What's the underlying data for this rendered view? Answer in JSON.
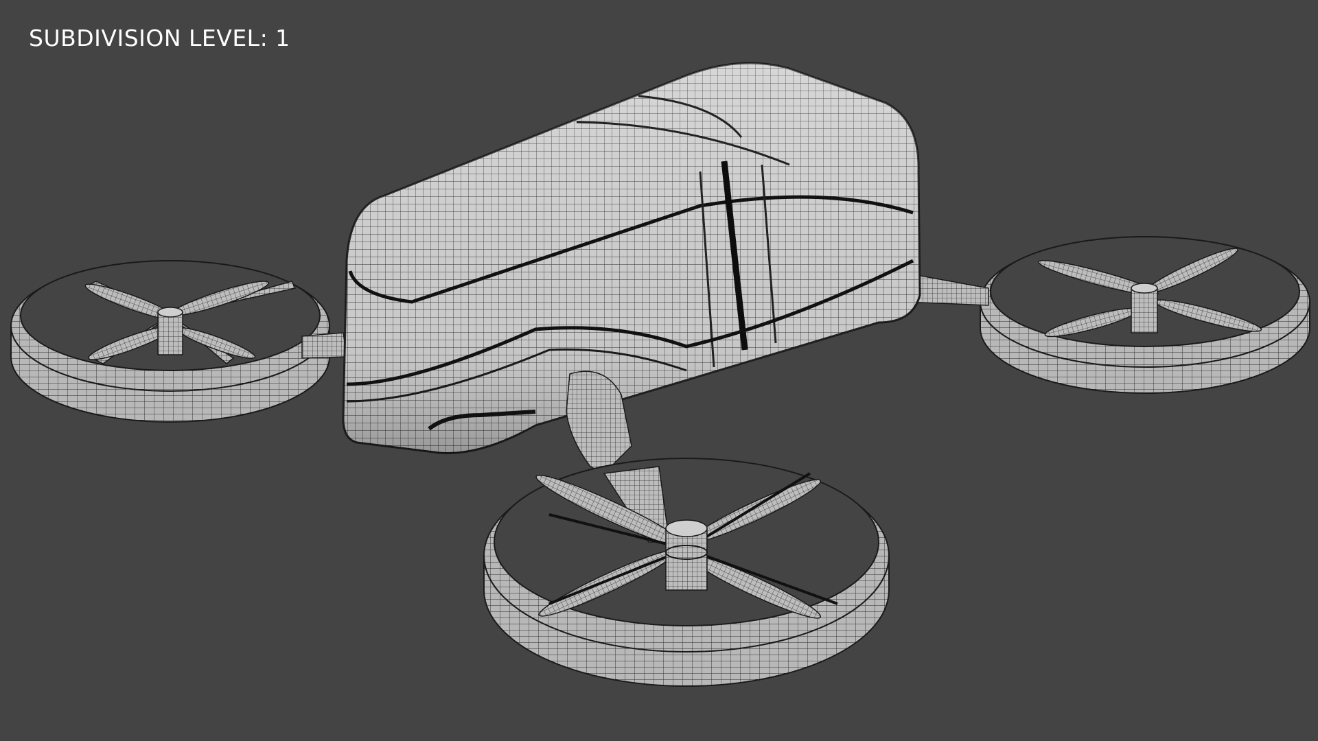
{
  "overlay": {
    "subdivision_label": "SUBDIVISION LEVEL: 1"
  },
  "viewport": {
    "background_color": "#444444",
    "mesh_fill_color": "#c8c8c8",
    "wire_color": "#222222",
    "object": "ducted-quadrotor-passenger-drone",
    "display_mode": "wireframe-on-shaded"
  }
}
